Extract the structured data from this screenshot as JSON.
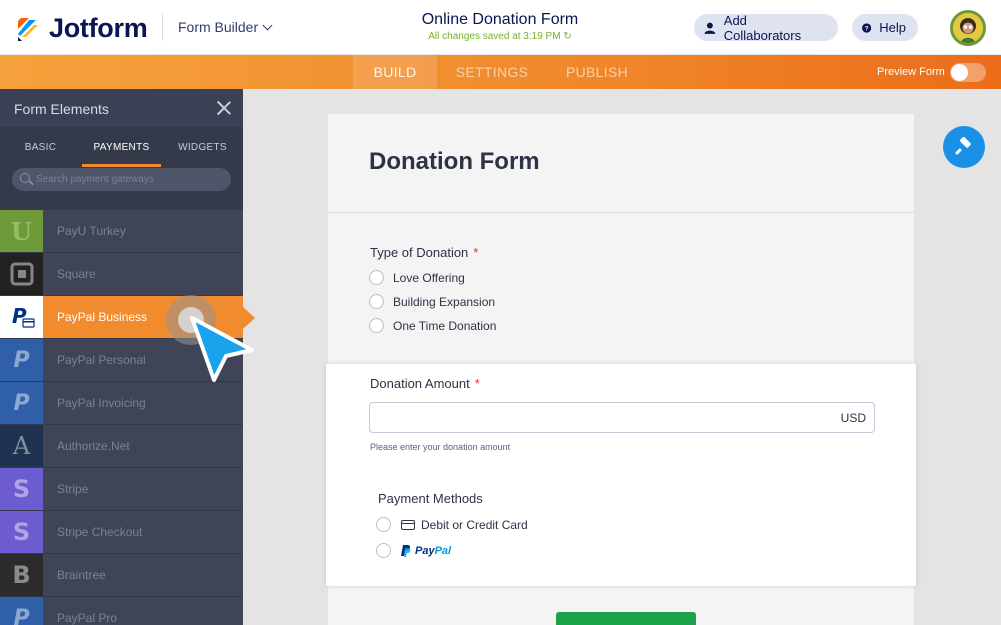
{
  "header": {
    "brand": "Jotform",
    "builder_menu": "Form Builder",
    "form_title": "Online Donation Form",
    "save_status": "All changes saved at 3:19 PM",
    "collab_label": "Add Collaborators",
    "help_label": "Help"
  },
  "nav": {
    "build": "BUILD",
    "settings": "SETTINGS",
    "publish": "PUBLISH",
    "preview_label": "Preview Form"
  },
  "sidebar": {
    "title": "Form Elements",
    "tabs": [
      "BASIC",
      "PAYMENTS",
      "WIDGETS"
    ],
    "search_placeholder": "Search payment gateways",
    "items": [
      {
        "label": "PayU Turkey",
        "icon": "payu-icon",
        "icon_char": "U",
        "color": "#6f9a3a"
      },
      {
        "label": "Square",
        "icon": "square-icon",
        "icon_char": "",
        "color": "#222222"
      },
      {
        "label": "PayPal Business",
        "icon": "paypal-icon",
        "icon_char": "P",
        "color": "#ffffff"
      },
      {
        "label": "PayPal Personal",
        "icon": "paypal-icon",
        "icon_char": "P",
        "color": "#2f5fa8"
      },
      {
        "label": "PayPal Invoicing",
        "icon": "paypal-icon",
        "icon_char": "P",
        "color": "#2f5fa8"
      },
      {
        "label": "Authorize.Net",
        "icon": "authorize-net-icon",
        "icon_char": "A",
        "color": "#1f3350"
      },
      {
        "label": "Stripe",
        "icon": "stripe-icon",
        "icon_char": "S",
        "color": "#6d5bd0"
      },
      {
        "label": "Stripe Checkout",
        "icon": "stripe-checkout-icon",
        "icon_char": "S",
        "color": "#6d5bd0"
      },
      {
        "label": "Braintree",
        "icon": "braintree-icon",
        "icon_char": "B",
        "color": "#2b2b2b"
      },
      {
        "label": "PayPal Pro",
        "icon": "paypal-icon",
        "icon_char": "P",
        "color": "#2f5fa8"
      }
    ]
  },
  "form": {
    "heading": "Donation Form",
    "type_label": "Type of Donation",
    "required_mark": "*",
    "type_options": [
      "Love Offering",
      "Building Expansion",
      "One Time Donation"
    ],
    "amount_label": "Donation Amount",
    "amount_value": "",
    "currency": "USD",
    "amount_sublabel": "Please enter your donation amount",
    "payment_label": "Payment Methods",
    "payment_card": "Debit or Credit Card",
    "paypal_pay": "Pay",
    "paypal_pal": "Pal"
  },
  "colors": {
    "accent_orange": "#f28b2e",
    "brand_navy": "#0a1551",
    "save_green": "#74b22c",
    "tool_blue": "#1a8fe6",
    "cursor_blue": "#1aa2ec"
  }
}
